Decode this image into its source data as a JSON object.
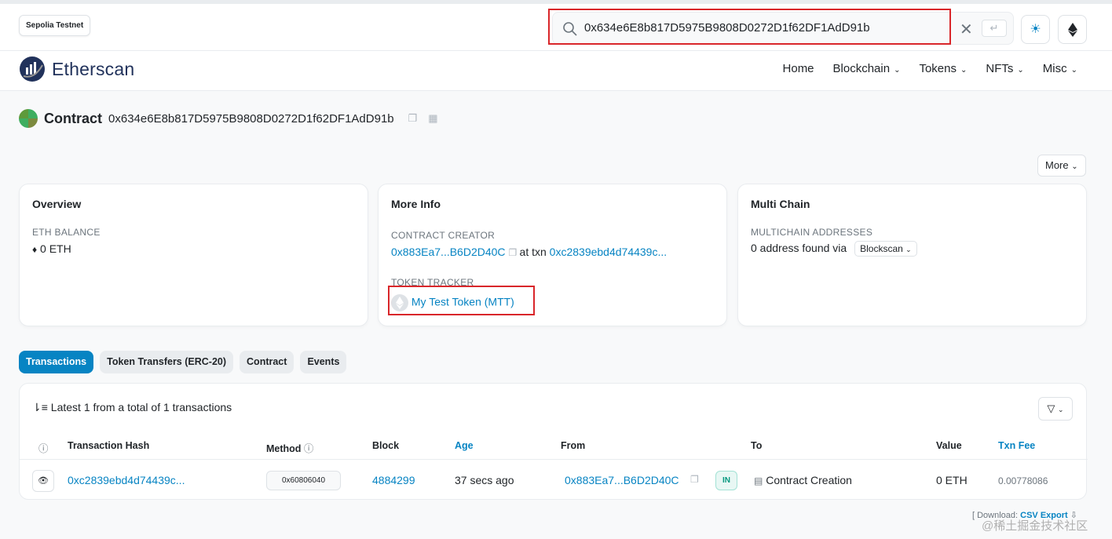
{
  "network": "Sepolia Testnet",
  "search": {
    "value": "0x634e6E8b817D5975B9808D0272D1f62DF1AdD91b"
  },
  "logo_text": "Etherscan",
  "menu": [
    "Home",
    "Blockchain",
    "Tokens",
    "NFTs",
    "Misc"
  ],
  "contract": {
    "label": "Contract",
    "address": "0x634e6E8b817D5975B9808D0272D1f62DF1AdD91b"
  },
  "more_label": "More",
  "overview": {
    "title": "Overview",
    "balance_label": "ETH BALANCE",
    "balance_value": "0 ETH"
  },
  "more_info": {
    "title": "More Info",
    "creator_label": "CONTRACT CREATOR",
    "creator": "0x883Ea7...B6D2D40C",
    "at_txn": "at txn",
    "creator_txn": "0xc2839ebd4d74439c...",
    "token_label": "TOKEN TRACKER",
    "token": "My Test Token (MTT)"
  },
  "multi_chain": {
    "title": "Multi Chain",
    "addresses_label": "MULTICHAIN ADDRESSES",
    "found": "0 address found via",
    "source": "Blockscan"
  },
  "tabs": [
    "Transactions",
    "Token Transfers (ERC-20)",
    "Contract",
    "Events"
  ],
  "table": {
    "summary": "Latest 1 from a total of 1 transactions",
    "headers": [
      "Transaction Hash",
      "Method",
      "Block",
      "Age",
      "From",
      "To",
      "Value",
      "Txn Fee"
    ],
    "row": {
      "hash": "0xc2839ebd4d74439c...",
      "method": "0x60806040",
      "block": "4884299",
      "age": "37 secs ago",
      "from": "0x883Ea7...B6D2D40C",
      "direction": "IN",
      "to": "Contract Creation",
      "value": "0 ETH",
      "fee": "0.00778086"
    }
  },
  "download": {
    "prefix": "[ Download:",
    "link": "CSV Export"
  },
  "watermark": "@稀土掘金技术社区"
}
